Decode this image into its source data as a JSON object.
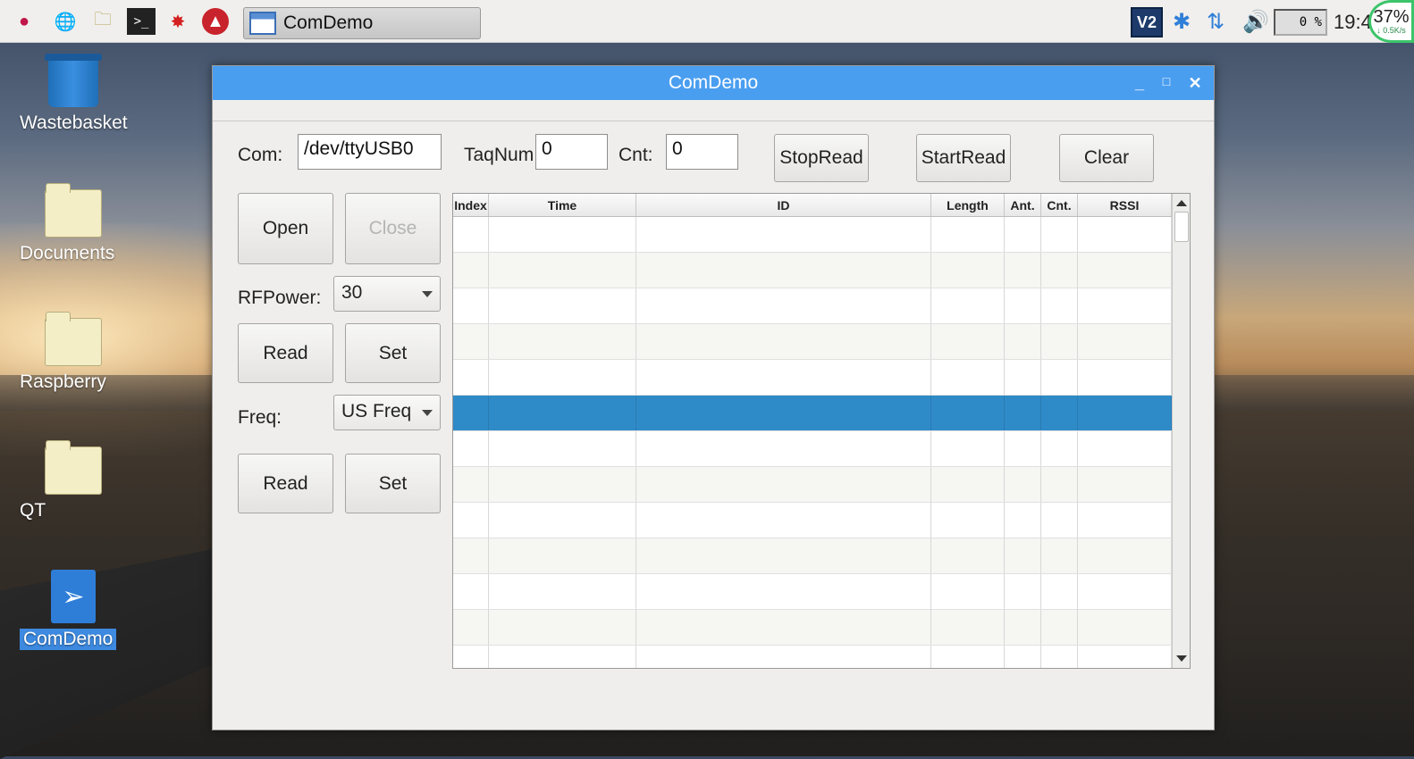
{
  "taskbar": {
    "task_title": "ComDemo",
    "cpu_usage": "0 %",
    "clock": "19:4",
    "net_percent": "37%",
    "net_speed": "↓ 0.5K/s",
    "vnc_label": "V2"
  },
  "desktop": {
    "icons": [
      {
        "label": "Wastebasket"
      },
      {
        "label": "Documents"
      },
      {
        "label": "Raspberry"
      },
      {
        "label": "QT"
      },
      {
        "label": "ComDemo"
      }
    ]
  },
  "window": {
    "title": "ComDemo",
    "com_label": "Com:",
    "com_value": "/dev/ttyUSB0",
    "tagnum_label": "TaqNum",
    "tagnum_value": "0",
    "cnt_label": "Cnt:",
    "cnt_value": "0",
    "stopread_label": "StopRead",
    "startread_label": "StartRead",
    "clear_label": "Clear",
    "open_label": "Open",
    "close_label": "Close",
    "rfpower_label": "RFPower:",
    "rfpower_value": "30",
    "rf_read_label": "Read",
    "rf_set_label": "Set",
    "freq_label": "Freq:",
    "freq_value": "US Freq",
    "freq_read_label": "Read",
    "freq_set_label": "Set"
  },
  "table": {
    "columns": [
      "Index",
      "Time",
      "ID",
      "Length",
      "Ant.",
      "Cnt.",
      "RSSI"
    ],
    "selected_row": 5,
    "row_count": 13
  },
  "colors": {
    "titlebar": "#4a9ef0",
    "selection": "#2f8ac8",
    "accent": "#2e7ed8"
  }
}
